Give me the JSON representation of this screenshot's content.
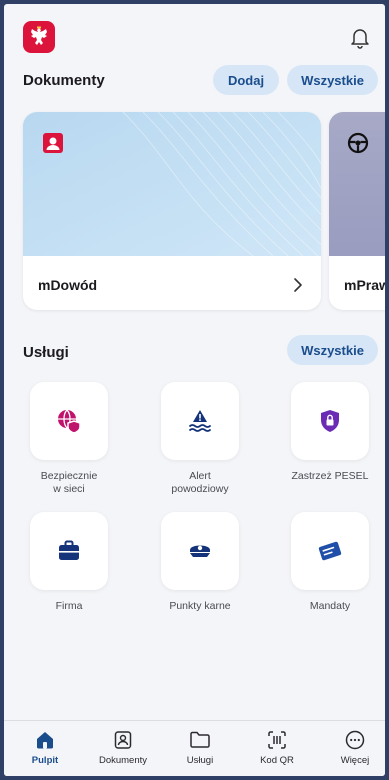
{
  "header": {
    "logo": "polish-eagle-emblem",
    "notifications_icon": "bell-icon"
  },
  "documents": {
    "title": "Dokumenty",
    "add_label": "Dodaj",
    "all_label": "Wszystkie",
    "cards": [
      {
        "label": "mDowód",
        "icon": "id-person-icon"
      },
      {
        "label": "mPraw",
        "icon": "steering-wheel-icon"
      }
    ]
  },
  "services": {
    "title": "Usługi",
    "all_label": "Wszystkie",
    "items": [
      {
        "label": "Bezpiecznie\nw sieci",
        "icon": "globe-shield-icon"
      },
      {
        "label": "Alert\npowodziowy",
        "icon": "flood-alert-icon"
      },
      {
        "label": "Zastrzeż PESEL",
        "icon": "lock-shield-icon"
      },
      {
        "label": "Firma",
        "icon": "briefcase-icon"
      },
      {
        "label": "Punkty karne",
        "icon": "police-cap-icon"
      },
      {
        "label": "Mandaty",
        "icon": "ticket-icon"
      }
    ]
  },
  "tabbar": {
    "tabs": [
      {
        "label": "Pulpit",
        "icon": "home-icon",
        "active": true
      },
      {
        "label": "Dokumenty",
        "icon": "document-icon"
      },
      {
        "label": "Usługi",
        "icon": "folder-icon"
      },
      {
        "label": "Kod QR",
        "icon": "qr-scan-icon"
      },
      {
        "label": "Więcej",
        "icon": "more-icon"
      }
    ]
  },
  "colors": {
    "accent": "#1a4d8c",
    "pill_bg": "#d7e6f7",
    "brand_red": "#dc143c",
    "icon_magenta": "#c0136b",
    "icon_purple": "#6b2bb5",
    "icon_navy": "#14337a"
  }
}
